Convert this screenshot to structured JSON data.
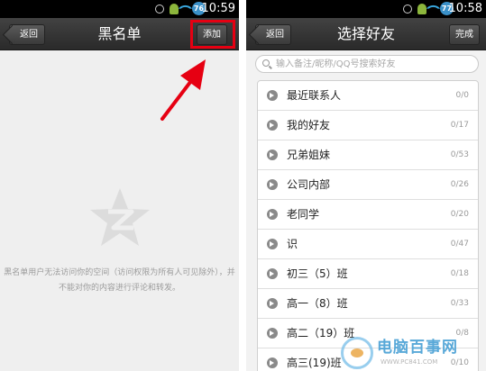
{
  "left_screen": {
    "status": {
      "time": "10:59",
      "battery": "76"
    },
    "title": "黑名单",
    "back_label": "返回",
    "add_label": "添加",
    "empty_text": "黑名单用户无法访问你的空间（访问权限为所有人可见除外），并不能对你的内容进行评论和转发。"
  },
  "right_screen": {
    "status": {
      "time": "10:58",
      "battery": "77"
    },
    "title": "选择好友",
    "back_label": "返回",
    "done_label": "完成",
    "search_placeholder": "输入备注/昵称/QQ号搜索好友",
    "groups": [
      {
        "name": "最近联系人",
        "count": "0/0"
      },
      {
        "name": "我的好友",
        "count": "0/17"
      },
      {
        "name": "兄弟姐妹",
        "count": "0/53"
      },
      {
        "name": "公司内部",
        "count": "0/26"
      },
      {
        "name": "老同学",
        "count": "0/20"
      },
      {
        "name": "识",
        "count": "0/47"
      },
      {
        "name": "初三（5）班",
        "count": "0/18"
      },
      {
        "name": "高一（8）班",
        "count": "0/33"
      },
      {
        "name": "高二（19）班",
        "count": "0/8"
      },
      {
        "name": "高三(19)班",
        "count": "0/10"
      }
    ]
  },
  "watermark": {
    "text": "电脑百事网",
    "url": "WWW.PC841.COM"
  },
  "colors": {
    "highlight": "#e60012",
    "statusbar": "#000000",
    "titlebar": "#333333"
  }
}
